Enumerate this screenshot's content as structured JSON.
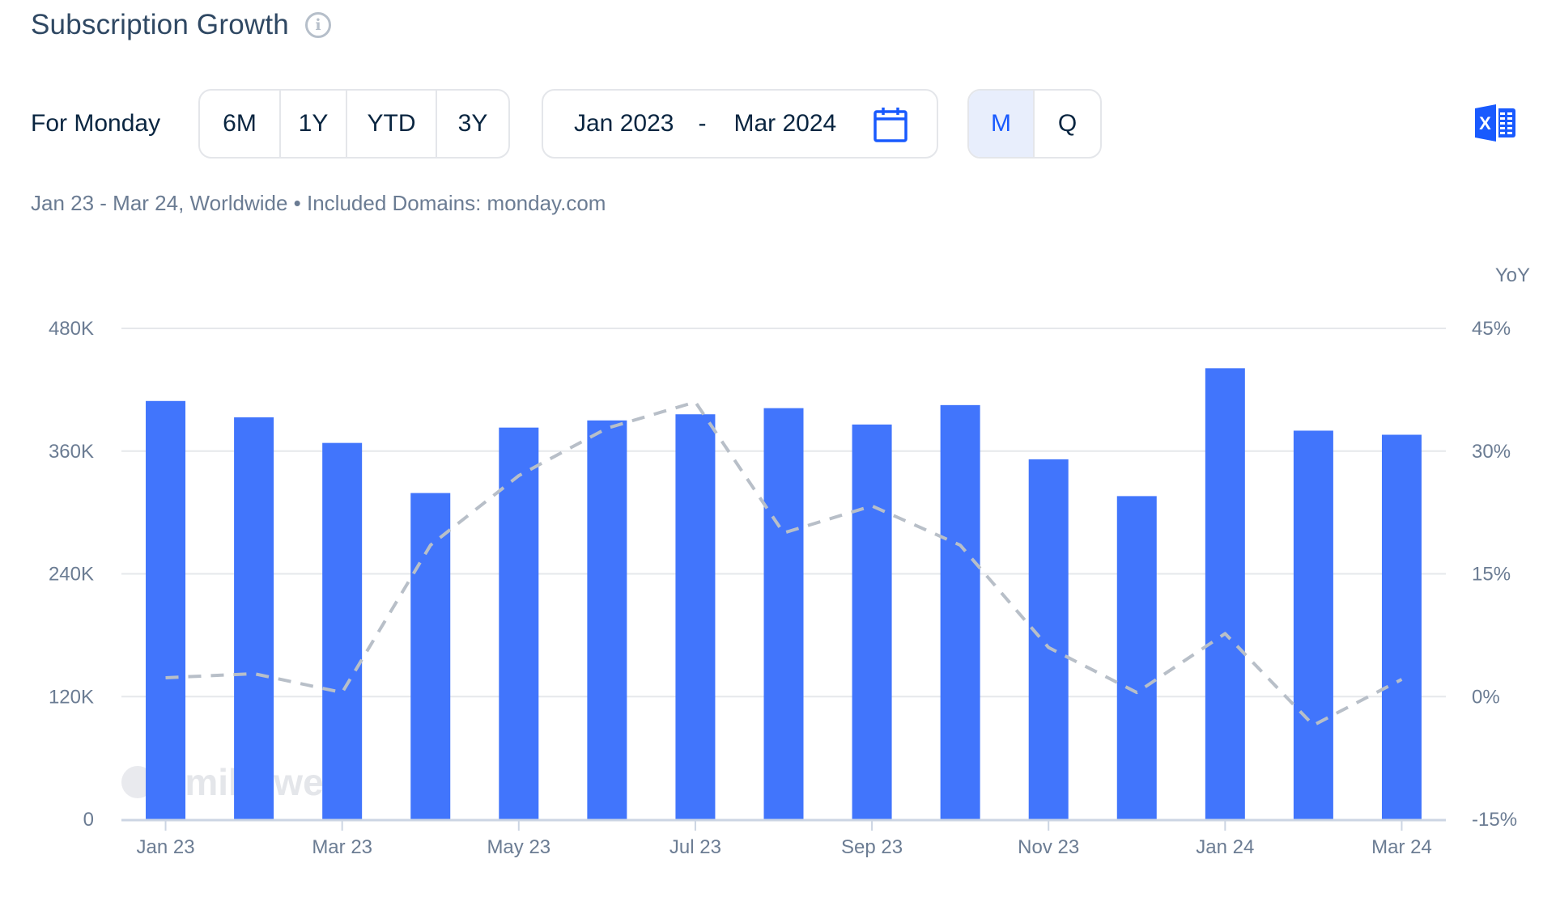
{
  "header": {
    "title": "Subscription Growth",
    "info_icon": "info-circle-icon"
  },
  "controls": {
    "for_label": "For Monday",
    "range_buttons": [
      {
        "label": "6M"
      },
      {
        "label": "1Y"
      },
      {
        "label": "YTD"
      },
      {
        "label": "3Y"
      }
    ],
    "date_range": {
      "start": "Jan 2023",
      "separator": "-",
      "end": "Mar 2024",
      "icon": "calendar-icon"
    },
    "period_buttons": [
      {
        "label": "M",
        "active": true
      },
      {
        "label": "Q",
        "active": false
      }
    ],
    "export_icon": "excel-icon"
  },
  "subtitle": "Jan 23 - Mar 24, Worldwide •  Included Domains: monday.com",
  "colors": {
    "bar": "#4175fc",
    "line": "#b8bfc8",
    "accent": "#195afe",
    "grid": "#e6e8eb",
    "axis_text": "#6b7c93"
  },
  "chart_data": {
    "type": "bar",
    "title": "Subscription Growth",
    "categories": [
      "Jan 23",
      "Feb 23",
      "Mar 23",
      "Apr 23",
      "May 23",
      "Jun 23",
      "Jul 23",
      "Aug 23",
      "Sep 23",
      "Oct 23",
      "Nov 23",
      "Dec 23",
      "Jan 24",
      "Feb 24",
      "Mar 24"
    ],
    "x_tick_labels": [
      "Jan 23",
      "",
      "Mar 23",
      "",
      "May 23",
      "",
      "Jul 23",
      "",
      "Sep 23",
      "",
      "Nov 23",
      "",
      "Jan 24",
      "",
      "Mar 24"
    ],
    "series": [
      {
        "name": "Subscriptions",
        "type": "bar",
        "axis": "left",
        "values": [
          409000,
          393000,
          368000,
          319000,
          383000,
          390000,
          396000,
          402000,
          386000,
          405000,
          352000,
          316000,
          441000,
          380000,
          376000
        ]
      },
      {
        "name": "YoY",
        "type": "line",
        "style": "dashed",
        "axis": "right",
        "values": [
          2.3,
          2.8,
          0.5,
          18.5,
          27.0,
          32.8,
          36.0,
          20.0,
          23.3,
          18.5,
          6.0,
          0.5,
          7.7,
          -3.5,
          2.1
        ]
      }
    ],
    "left_axis": {
      "ylim": [
        0,
        480000
      ],
      "ticks": [
        0,
        120000,
        240000,
        360000,
        480000
      ],
      "tick_labels": [
        "0",
        "120K",
        "240K",
        "360K",
        "480K"
      ]
    },
    "right_axis": {
      "label": "YoY",
      "ylim": [
        -15,
        45
      ],
      "ticks": [
        -15,
        0,
        15,
        30,
        45
      ],
      "tick_labels": [
        "-15%",
        "0%",
        "15%",
        "30%",
        "45%"
      ]
    },
    "grid": true,
    "watermark": "similarweb",
    "legend": "none"
  }
}
